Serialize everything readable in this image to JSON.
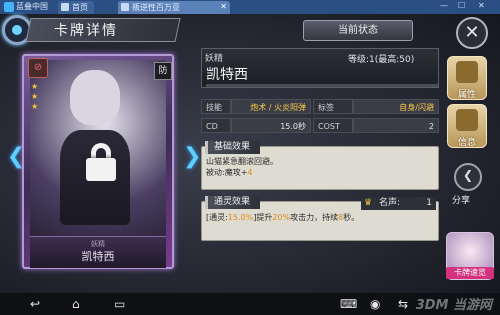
{
  "emulator": {
    "brand": "蓝叠中国",
    "tabs": [
      {
        "label": "首页"
      },
      {
        "label": "叛逆性百万亚"
      }
    ]
  },
  "header": {
    "title": "卡牌详情",
    "status_button": "当前状态"
  },
  "card": {
    "stamp": "⊘",
    "type_badge": "防",
    "sub_label": "妖精",
    "name": "凯特西"
  },
  "info": {
    "race": "妖精",
    "level": "等级:1(最高:50)",
    "name": "凯特西"
  },
  "stats": {
    "skill_label": "技能",
    "skill_value": "炮术 / 火炎阳弹",
    "tag_label": "标签",
    "tag_value": "自身/闪避",
    "cd_label": "CD",
    "cd_value": "15.0秒",
    "cost_label": "COST",
    "cost_value": "2"
  },
  "base_effect": {
    "title": "基础效果",
    "line1": "山猫紧急翻滚回避。",
    "line2_prefix": "被动:魔攻+",
    "line2_value": "4"
  },
  "spirit_effect": {
    "title": "通灵效果",
    "fame_label": "名声:",
    "fame_value": "1",
    "text_p1": "[通灵:",
    "text_v1": "15.0%",
    "text_p2": "]提升",
    "text_v2": "20%",
    "text_p3": "攻击力，持续",
    "text_v3": "8",
    "text_p4": "秒。"
  },
  "side": {
    "attribute": "属性",
    "info": "信息",
    "share": "分享",
    "guide": "卡牌速览"
  },
  "watermark": "3DM 当游网"
}
